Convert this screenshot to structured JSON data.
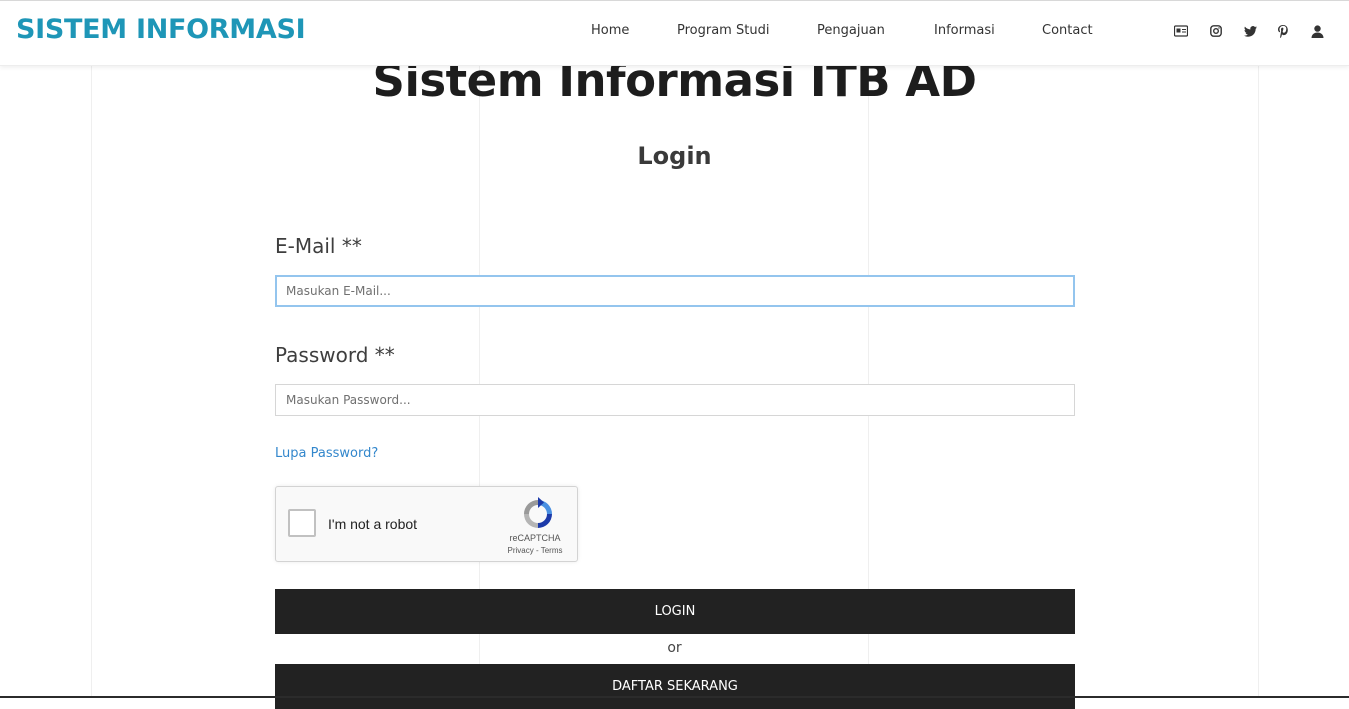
{
  "header": {
    "brand": "SISTEM INFORMASI",
    "nav": [
      {
        "label": "Home"
      },
      {
        "label": "Program Studi"
      },
      {
        "label": "Pengajuan"
      },
      {
        "label": "Informasi"
      },
      {
        "label": "Contact"
      }
    ],
    "social_icons": [
      "contact-card-icon",
      "instagram-icon",
      "twitter-icon",
      "pinterest-icon",
      "user-icon"
    ]
  },
  "main": {
    "title": "Sistem Informasi ITB AD",
    "subtitle": "Login",
    "email": {
      "label": "E-Mail **",
      "placeholder": "Masukan E-Mail...",
      "value": ""
    },
    "password": {
      "label": "Password **",
      "placeholder": "Masukan Password...",
      "value": ""
    },
    "forgot_password": "Lupa Password?",
    "captcha": {
      "label": "I'm not a robot",
      "brand": "reCAPTCHA",
      "links": "Privacy - Terms"
    },
    "login_button": "LOGIN",
    "or_text": "or",
    "register_button": "DAFTAR SEKARANG"
  },
  "colors": {
    "brand": "#1e96b7",
    "button_bg": "#222222",
    "link": "#3387cc",
    "focus_border": "#94c5ee"
  }
}
